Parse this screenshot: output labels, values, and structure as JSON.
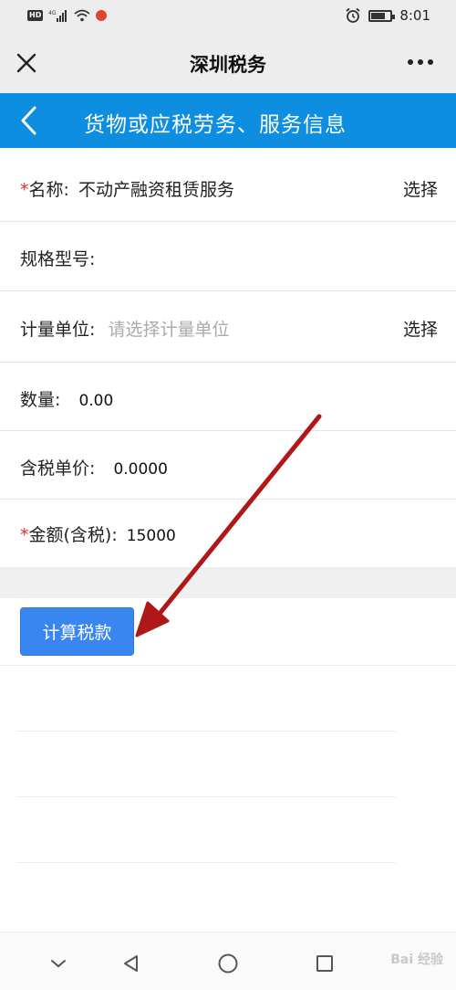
{
  "status_bar": {
    "left_badges": [
      "HD",
      "4G"
    ],
    "time": "8:01",
    "icons": [
      "hd-icon",
      "signal-icon",
      "wifi-icon",
      "notification-icon",
      "alarm-icon",
      "battery-icon"
    ]
  },
  "title_bar": {
    "title": "深圳税务",
    "close_icon": "close-icon",
    "more_icon": "more-icon"
  },
  "header": {
    "title": "货物或应税劳务、服务信息",
    "back_icon": "back-icon",
    "color": "#0e8ee0"
  },
  "form": {
    "name": {
      "required": "*",
      "label": "名称:",
      "value": "不动产融资租赁服务",
      "action": "选择"
    },
    "spec": {
      "label": "规格型号:"
    },
    "unit": {
      "label": "计量单位:",
      "placeholder": "请选择计量单位",
      "action": "选择"
    },
    "quantity": {
      "label": "数量:",
      "value": "0.00"
    },
    "unit_price": {
      "label": "含税单价:",
      "value": "0.0000"
    },
    "amount": {
      "required": "*",
      "label": "金额(含税):",
      "value": "15000"
    }
  },
  "calc_button": {
    "label": "计算税款",
    "color": "#3a86f0"
  },
  "nav_bar": {
    "icons": [
      "collapse-icon",
      "back-triangle-icon",
      "home-circle-icon",
      "recent-square-icon"
    ]
  },
  "watermark": {
    "text": "Bai 经验"
  },
  "annotation": {
    "color": "#b01818"
  }
}
